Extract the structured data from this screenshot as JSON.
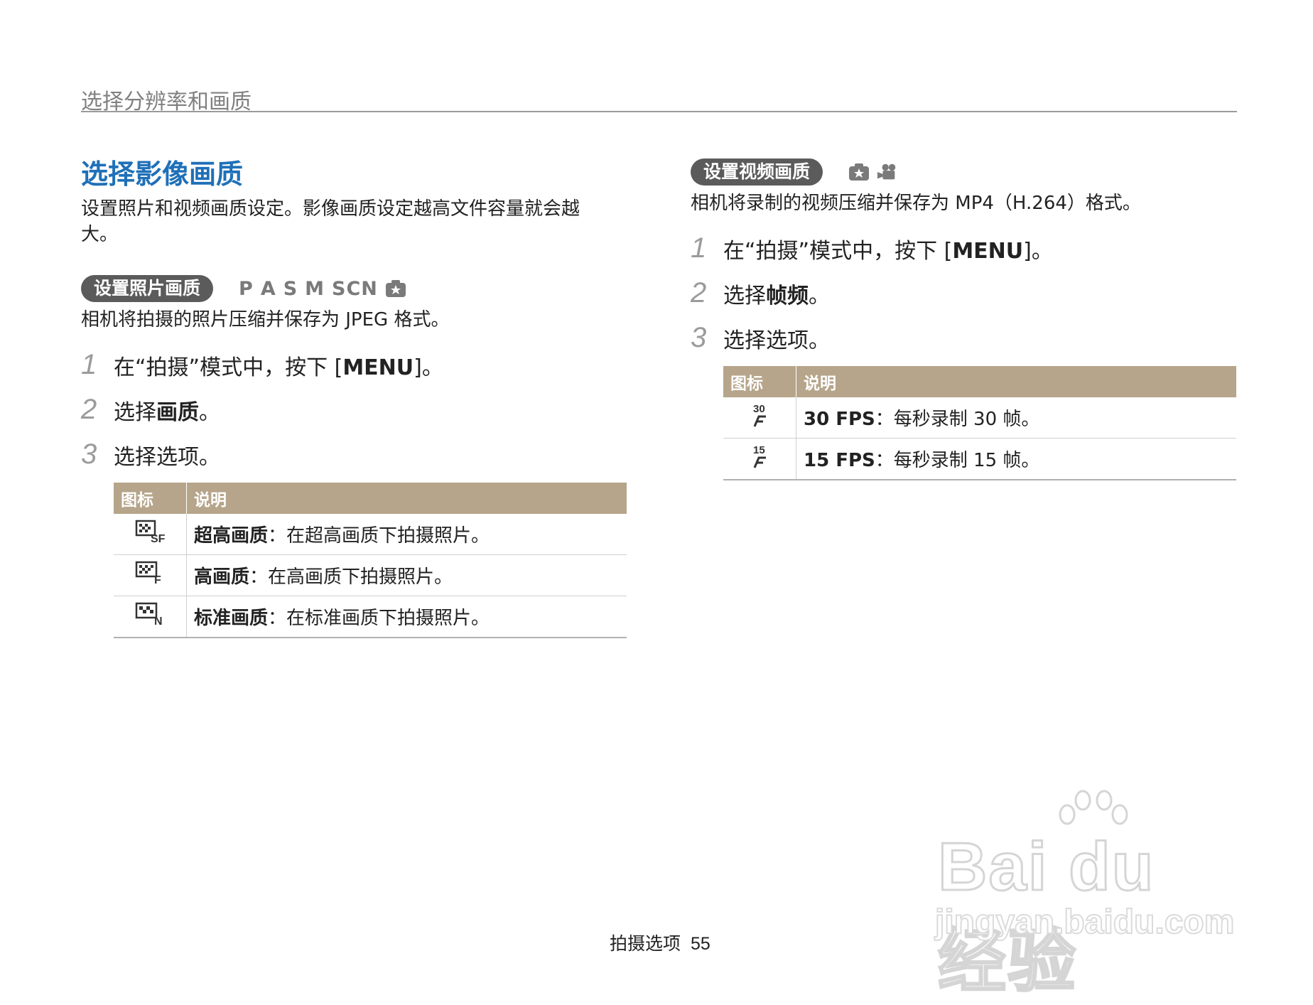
{
  "header": {
    "title": "选择分辨率和画质"
  },
  "left": {
    "title": "选择影像画质",
    "intro": "设置照片和视频画质设定。影像画质设定越高文件容量就会越大。",
    "section_label": "设置照片画质",
    "modes": [
      "P",
      "A",
      "S",
      "M",
      "SCN"
    ],
    "mode_icon": "smart-auto-icon",
    "desc": "相机将拍摄的照片压缩并保存为 JPEG 格式。",
    "steps": [
      {
        "num": "1",
        "text_pre": "在“拍摄”模式中，按下 [",
        "key": "MENU",
        "text_post": "]。"
      },
      {
        "num": "2",
        "text_pre": "选择",
        "bold": "画质",
        "text_post": "。"
      },
      {
        "num": "3",
        "text": "选择选项。"
      }
    ],
    "table": {
      "headers": [
        "图标",
        "说明"
      ],
      "rows": [
        {
          "icon": "quality-super-fine-icon",
          "bold": "超高画质",
          "text": "：在超高画质下拍摄照片。"
        },
        {
          "icon": "quality-fine-icon",
          "bold": "高画质",
          "text": "：在高画质下拍摄照片。"
        },
        {
          "icon": "quality-normal-icon",
          "bold": "标准画质",
          "text": "：在标准画质下拍摄照片。"
        }
      ]
    }
  },
  "right": {
    "section_label": "设置视频画质",
    "mode_icons": [
      "smart-auto-icon",
      "movie-camera-icon"
    ],
    "desc": "相机将录制的视频压缩并保存为 MP4（H.264）格式。",
    "steps": [
      {
        "num": "1",
        "text_pre": "在“拍摄”模式中，按下 [",
        "key": "MENU",
        "text_post": "]。"
      },
      {
        "num": "2",
        "text_pre": "选择",
        "bold": "帧频",
        "text_post": "。"
      },
      {
        "num": "3",
        "text": "选择选项。"
      }
    ],
    "table": {
      "headers": [
        "图标",
        "说明"
      ],
      "rows": [
        {
          "icon": "fps-30-icon",
          "icon_text": "30",
          "bold": "30 FPS",
          "text": "：每秒录制 30 帧。"
        },
        {
          "icon": "fps-15-icon",
          "icon_text": "15",
          "bold": "15 FPS",
          "text": "：每秒录制 15 帧。"
        }
      ]
    }
  },
  "footer": {
    "section": "拍摄选项",
    "page": "55"
  },
  "watermark": {
    "logo": "Bai du 经验",
    "url": "jingyan.baidu.com"
  }
}
